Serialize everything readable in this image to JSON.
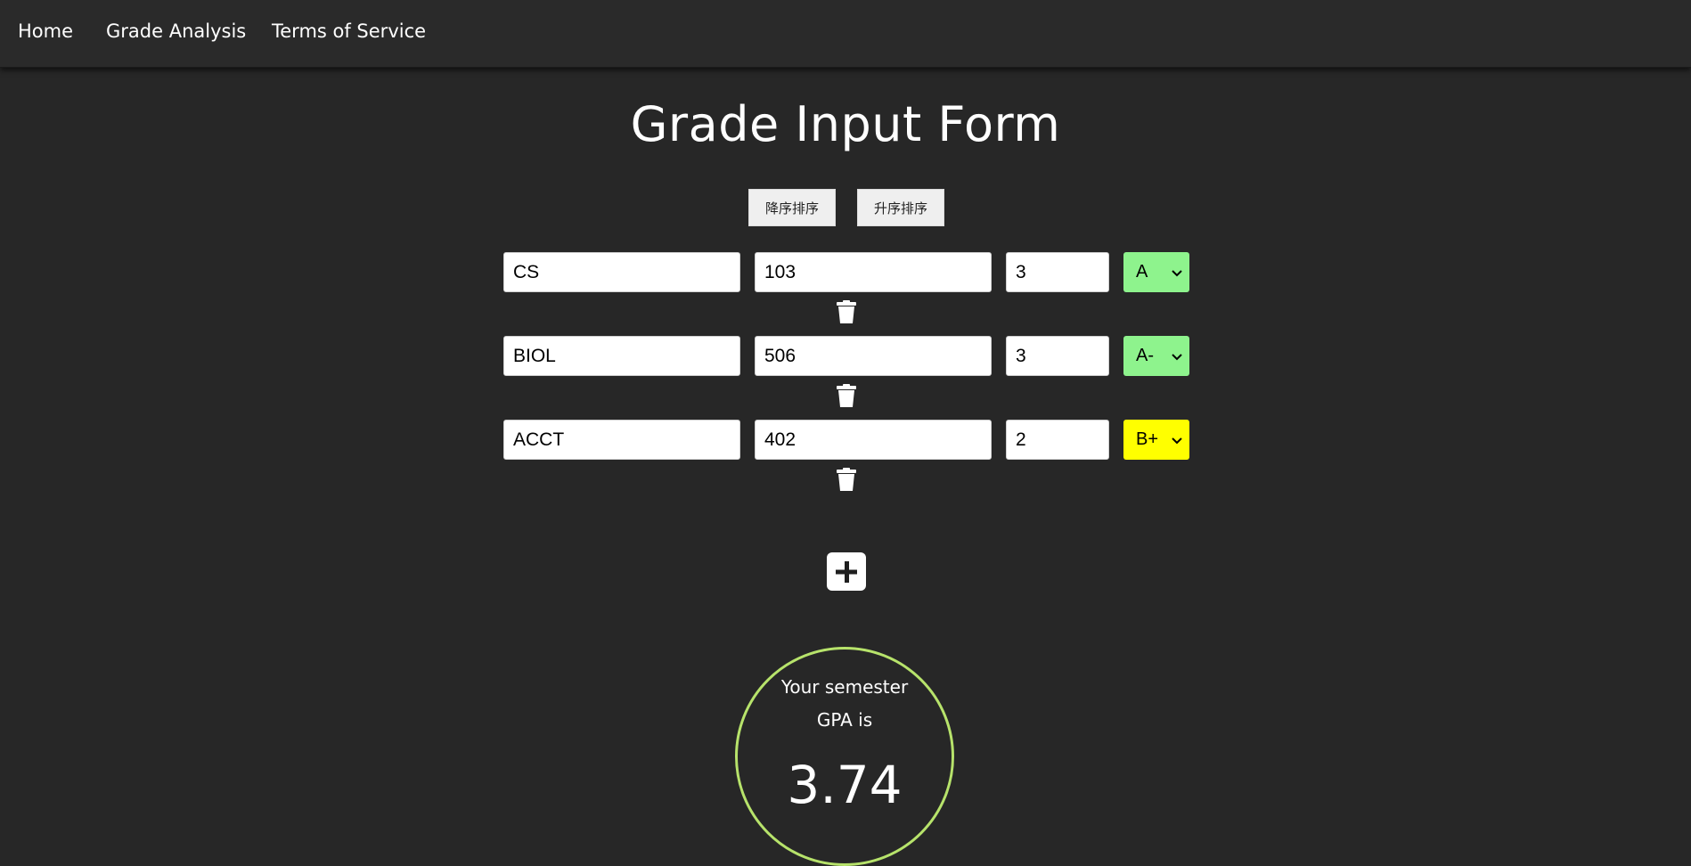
{
  "nav": {
    "links": [
      "Home",
      "Grade Analysis",
      "Terms of Service"
    ]
  },
  "page_title": "Grade Input Form",
  "sort_buttons": {
    "descending": "降序排序",
    "ascending": "升序排序"
  },
  "courses": [
    {
      "subject": "CS",
      "number": "103",
      "credits": "3",
      "grade": "A",
      "grade_color": "#8ef38d"
    },
    {
      "subject": "BIOL",
      "number": "506",
      "credits": "3",
      "grade": "A-",
      "grade_color": "#8ef38d"
    },
    {
      "subject": "ACCT",
      "number": "402",
      "credits": "2",
      "grade": "B+",
      "grade_color": "#ffff00"
    }
  ],
  "icons": {
    "delete": "trash-icon",
    "add": "plus-icon",
    "select": "chevron-down-icon"
  },
  "gpa": {
    "label": "Your semester GPA is",
    "value": "3.74",
    "ring_color": "#b7e36b"
  }
}
